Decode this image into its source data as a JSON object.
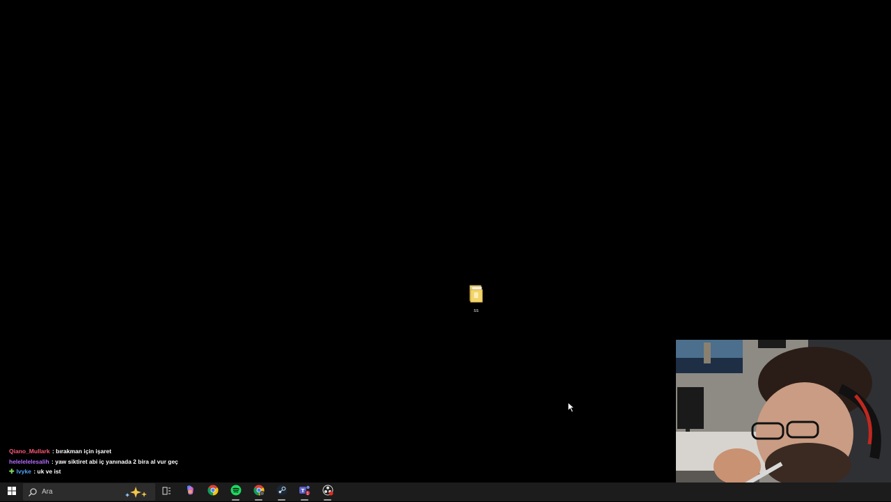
{
  "desktop": {
    "icons": [
      {
        "label": "ss",
        "icon": "folder-icon"
      }
    ]
  },
  "chat": {
    "messages": [
      {
        "user": "Qiano_Mullark",
        "separator": " : ",
        "text": "bırakman için işaret",
        "user_color": "#ff5a7a"
      },
      {
        "user": "helelelelesalih",
        "separator": " : ",
        "text": "yaw siktiret abi iç yanınada 2 bira al vur geç",
        "user_color": "#b56cff"
      },
      {
        "user": "lvyke",
        "separator": " : ",
        "text": "uk ve ist",
        "user_color": "#4fa3ff",
        "badge": "✚"
      }
    ]
  },
  "webcam": {
    "icon": "webcam-feed"
  },
  "taskbar": {
    "search_placeholder": "Ara",
    "items": [
      {
        "icon": "windows-start-icon"
      },
      {
        "icon": "search-icon"
      },
      {
        "icon": "copilot-sparkle-icon"
      },
      {
        "icon": "task-view-icon"
      },
      {
        "icon": "copilot-icon"
      },
      {
        "icon": "chrome-icon"
      },
      {
        "icon": "spotify-icon"
      },
      {
        "icon": "chrome-profile-icon"
      },
      {
        "icon": "steam-icon"
      },
      {
        "icon": "teams-icon",
        "badge": "1"
      },
      {
        "icon": "obs-icon"
      }
    ]
  },
  "colors": {
    "taskbar_bg": "#1c1c1c",
    "desktop_bg": "#000000",
    "chat_text": "#ffffff"
  }
}
